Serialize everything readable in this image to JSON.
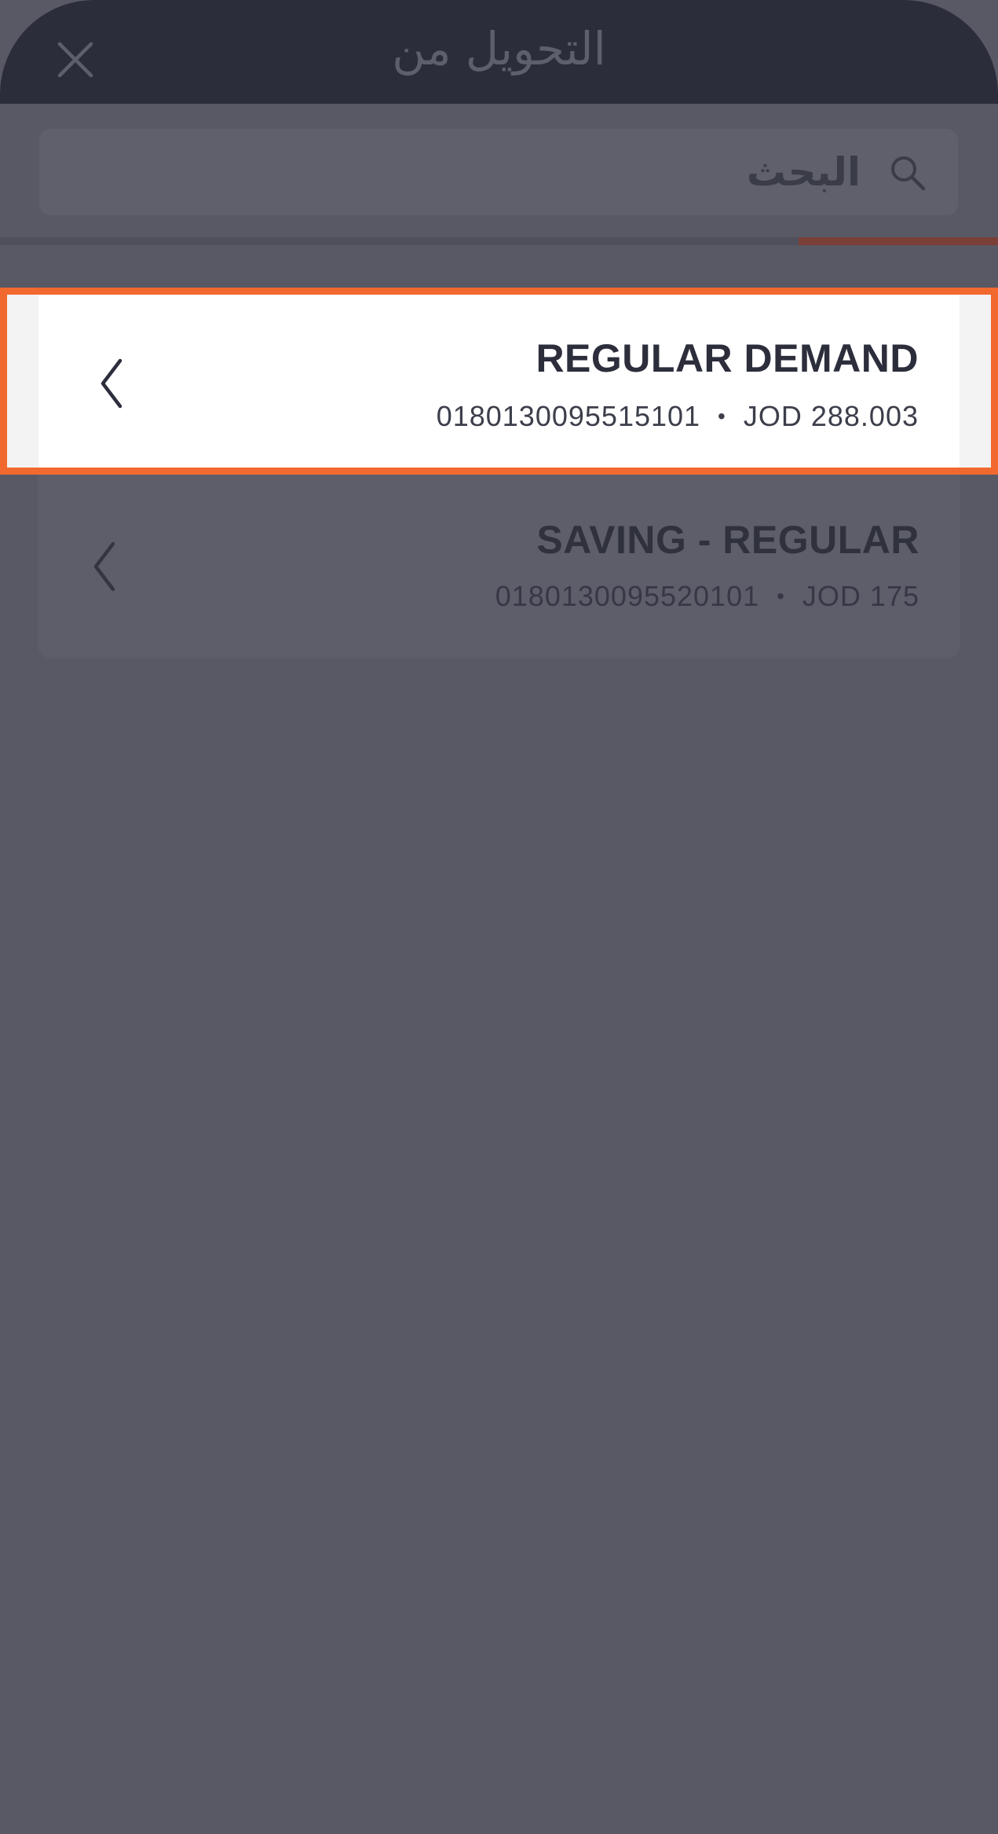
{
  "header": {
    "title": "التحويل من",
    "close_icon": "close-icon"
  },
  "search": {
    "placeholder": "البحث",
    "icon": "search-icon"
  },
  "accounts": [
    {
      "name": "REGULAR DEMAND",
      "number": "0180130095515101",
      "separator": "•",
      "balance": "JOD 288.003",
      "selected": true
    },
    {
      "name": "SAVING - REGULAR",
      "number": "0180130095520101",
      "separator": "•",
      "balance": "JOD 175",
      "selected": false
    }
  ],
  "colors": {
    "highlight": "#f2692f",
    "header_bg": "#2b2d3a",
    "overlay_bg": "#595965",
    "tab_accent": "#7a3f36"
  }
}
